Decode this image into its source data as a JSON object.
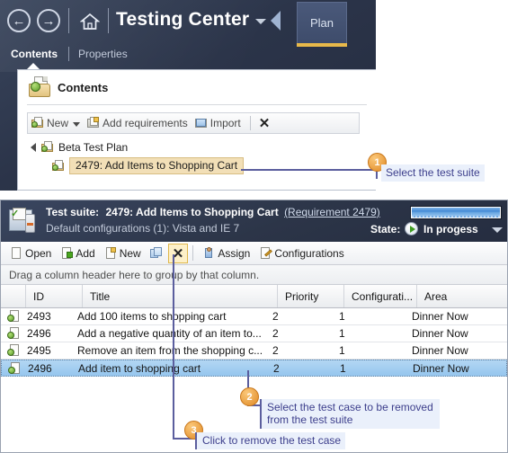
{
  "panel1": {
    "nav": {
      "back_icon": "arrow-left-circle-icon",
      "forward_icon": "arrow-right-circle-icon",
      "home_icon": "home-icon",
      "title": "Testing Center",
      "dropdown_icon": "chevron-down-icon",
      "prev_arrow_icon": "triangle-left-icon",
      "active_tab": "Plan",
      "accent_color": "#e8b94a"
    },
    "tabs": [
      {
        "label": "Contents",
        "active": true
      },
      {
        "label": "Properties",
        "active": false
      }
    ],
    "card": {
      "header_icon": "folder-document-icon",
      "header_title": "Contents",
      "toolbar": [
        {
          "label": "New",
          "icon": "new-folder-icon",
          "has_caret": true
        },
        {
          "label": "Add requirements",
          "icon": "add-requirements-icon",
          "has_caret": false
        },
        {
          "label": "Import",
          "icon": "import-icon",
          "has_caret": false
        }
      ],
      "toolbar_delete_icon": "close-x-icon",
      "tree": {
        "expander_icon": "triangle-right-icon",
        "root": {
          "label": "Beta Test Plan",
          "icon": "test-plan-icon"
        },
        "child": {
          "label": "2479: Add Items to Shopping Cart",
          "icon": "test-suite-icon",
          "selected": true
        }
      }
    }
  },
  "panel2": {
    "header": {
      "suite_icon": "test-suite-clock-icon",
      "prefix": "Test suite:",
      "title": "2479: Add Items to Shopping Cart",
      "requirement_link": "(Requirement 2479)",
      "subtitle": "Default configurations (1): Vista and IE 7",
      "progress_percent": 100,
      "state_label": "State:",
      "state_icon": "play-circle-icon",
      "state_value": "In progess",
      "state_caret_icon": "chevron-down-icon"
    },
    "toolbar": [
      {
        "label": "Open",
        "icon": "open-document-icon"
      },
      {
        "label": "Add",
        "icon": "add-item-icon"
      },
      {
        "label": "New",
        "icon": "new-item-icon"
      },
      {
        "label": "",
        "icon": "copy-icon"
      }
    ],
    "toolbar_delete": {
      "label": "✕",
      "icon": "close-x-icon",
      "highlighted": true
    },
    "toolbar_right": [
      {
        "label": "Assign",
        "icon": "assign-user-icon"
      },
      {
        "label": "Configurations",
        "icon": "configurations-icon"
      }
    ],
    "group_bar_text": "Drag a column header here to group by that column.",
    "grid": {
      "columns": [
        "",
        "ID",
        "Title",
        "Priority",
        "Configurati...",
        "Area"
      ],
      "rows": [
        {
          "icon": "test-case-icon",
          "id": "2493",
          "title": "Add 100 items to shopping cart",
          "priority": "2",
          "configurations": "1",
          "area": "Dinner Now",
          "selected": false
        },
        {
          "icon": "test-case-icon",
          "id": "2496",
          "title": "Add a negative quantity of an item to...",
          "priority": "2",
          "configurations": "1",
          "area": "Dinner Now",
          "selected": false
        },
        {
          "icon": "test-case-icon",
          "id": "2495",
          "title": "Remove an item from the shopping c...",
          "priority": "2",
          "configurations": "1",
          "area": "Dinner Now",
          "selected": false
        },
        {
          "icon": "test-case-icon",
          "id": "2496",
          "title": "Add item to shopping cart",
          "priority": "2",
          "configurations": "1",
          "area": "Dinner Now",
          "selected": true
        }
      ]
    }
  },
  "callouts": [
    {
      "number": "1",
      "text": "Select the test suite"
    },
    {
      "number": "2",
      "text": "Select the test case to be removed from the test suite"
    },
    {
      "number": "3",
      "text": "Click to remove the test case"
    }
  ],
  "colors": {
    "header_dark": "#2c3548",
    "callout_badge": "#e08a25",
    "callout_text": "#3d3f8c",
    "selection_blue": "#95c6ee",
    "tree_selection": "#f2dfb7",
    "tab_accent": "#e8b94a"
  }
}
